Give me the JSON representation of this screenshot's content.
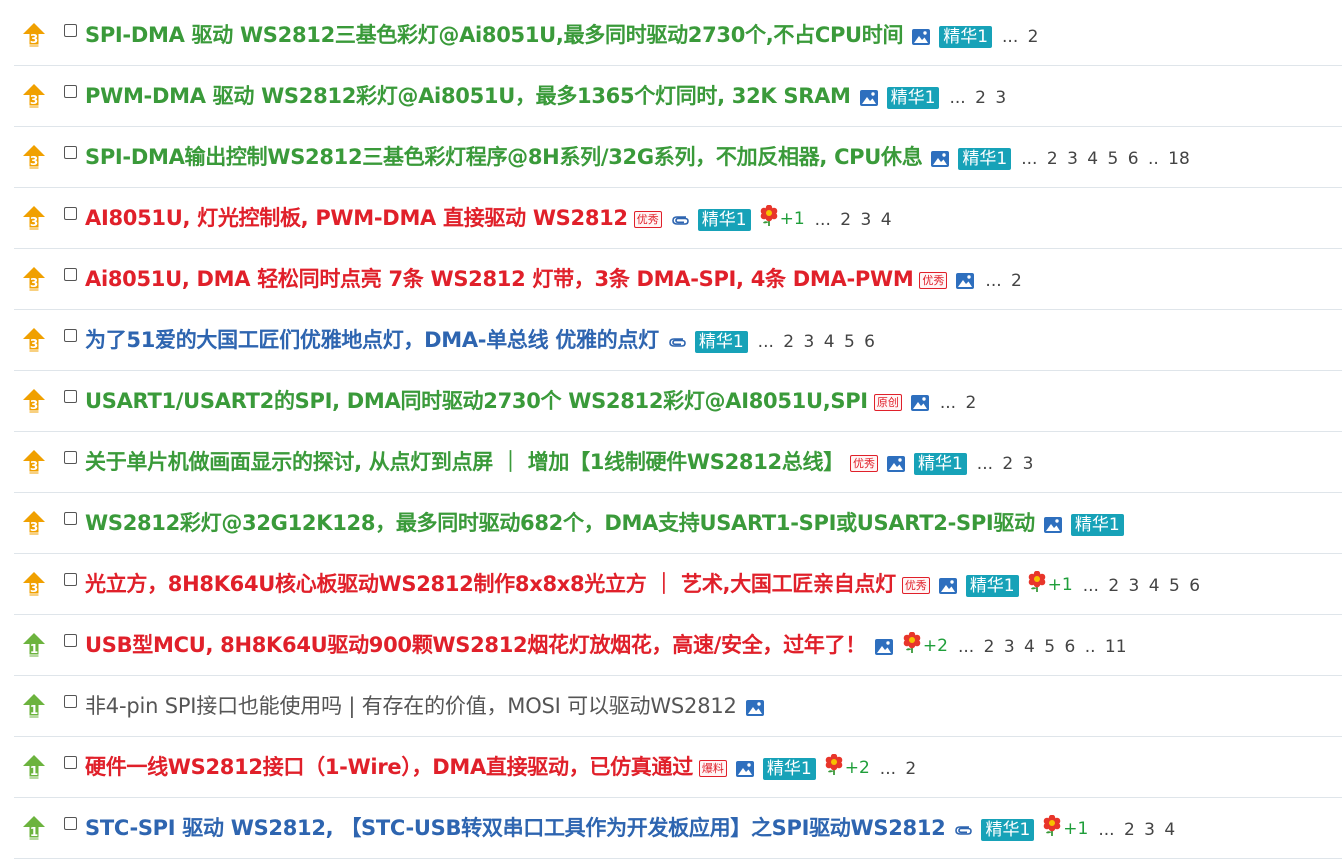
{
  "threads": [
    {
      "badge": "3",
      "badge_color": "#f0a000",
      "color": "green",
      "title": "SPI-DMA 驱动 WS2812三基色彩灯@Ai8051U,最多同时驱动2730个,不占CPU时间",
      "tag": "",
      "clip": false,
      "image": true,
      "jinghua": "精华1",
      "flower": "",
      "pages": "... 2"
    },
    {
      "badge": "3",
      "badge_color": "#f0a000",
      "color": "green",
      "title": "PWM-DMA 驱动 WS2812彩灯@Ai8051U，最多1365个灯同时, 32K SRAM",
      "tag": "",
      "clip": false,
      "image": true,
      "jinghua": "精华1",
      "flower": "",
      "pages": "... 2 3"
    },
    {
      "badge": "3",
      "badge_color": "#f0a000",
      "color": "green",
      "title": "SPI-DMA输出控制WS2812三基色彩灯程序@8H系列/32G系列，不加反相器, CPU休息",
      "tag": "",
      "clip": false,
      "image": true,
      "jinghua": "精华1",
      "flower": "",
      "pages": "... 2 3 4 5 6 .. 18"
    },
    {
      "badge": "3",
      "badge_color": "#f0a000",
      "color": "red",
      "title": "AI8051U, 灯光控制板, PWM-DMA 直接驱动 WS2812",
      "tag": "优秀",
      "clip": true,
      "image": false,
      "jinghua": "精华1",
      "flower": "+1",
      "pages": "... 2 3 4"
    },
    {
      "badge": "3",
      "badge_color": "#f0a000",
      "color": "red",
      "title": "Ai8051U, DMA 轻松同时点亮 7条 WS2812 灯带，3条 DMA-SPI, 4条 DMA-PWM",
      "tag": "优秀",
      "clip": false,
      "image": true,
      "jinghua": "",
      "flower": "",
      "pages": "... 2"
    },
    {
      "badge": "3",
      "badge_color": "#f0a000",
      "color": "blue",
      "title": "为了51爱的大国工匠们优雅地点灯，DMA-单总线 优雅的点灯",
      "tag": "",
      "clip": true,
      "image": false,
      "jinghua": "精华1",
      "flower": "",
      "pages": "... 2 3 4 5 6"
    },
    {
      "badge": "3",
      "badge_color": "#f0a000",
      "color": "green",
      "title": "USART1/USART2的SPI, DMA同时驱动2730个 WS2812彩灯@AI8051U,SPI",
      "tag": "原创",
      "clip": false,
      "image": true,
      "jinghua": "",
      "flower": "",
      "pages": "... 2"
    },
    {
      "badge": "3",
      "badge_color": "#f0a000",
      "color": "green",
      "title": "关于单片机做画面显示的探讨, 从点灯到点屏 ｜ 增加【1线制硬件WS2812总线】",
      "tag": "优秀",
      "clip": false,
      "image": true,
      "jinghua": "精华1",
      "flower": "",
      "pages": "... 2 3"
    },
    {
      "badge": "3",
      "badge_color": "#f0a000",
      "color": "green",
      "title": "WS2812彩灯@32G12K128，最多同时驱动682个，DMA支持USART1-SPI或USART2-SPI驱动",
      "tag": "",
      "clip": false,
      "image": true,
      "jinghua": "精华1",
      "flower": "",
      "pages": ""
    },
    {
      "badge": "3",
      "badge_color": "#f0a000",
      "color": "red",
      "title": "光立方，8H8K64U核心板驱动WS2812制作8x8x8光立方 ｜ 艺术,大国工匠亲自点灯",
      "tag": "优秀",
      "clip": false,
      "image": true,
      "jinghua": "精华1",
      "flower": "+1",
      "pages": "... 2 3 4 5 6"
    },
    {
      "badge": "1",
      "badge_color": "#6cb33e",
      "color": "red",
      "title": "USB型MCU, 8H8K64U驱动900颗WS2812烟花灯放烟花，高速/安全，过年了！",
      "tag": "",
      "clip": false,
      "image": true,
      "jinghua": "",
      "flower": "+2",
      "pages": "... 2 3 4 5 6 .. 11"
    },
    {
      "badge": "1",
      "badge_color": "#6cb33e",
      "color": "gray",
      "title": "非4-pin SPI接口也能使用吗 | 有存在的价值，MOSI 可以驱动WS2812",
      "tag": "",
      "clip": false,
      "image": true,
      "jinghua": "",
      "flower": "",
      "pages": ""
    },
    {
      "badge": "1",
      "badge_color": "#6cb33e",
      "color": "red",
      "title": "硬件一线WS2812接口（1-Wire），DMA直接驱动，已仿真通过",
      "tag": "爆料",
      "clip": false,
      "image": true,
      "jinghua": "精华1",
      "flower": "+2",
      "pages": "... 2"
    },
    {
      "badge": "1",
      "badge_color": "#6cb33e",
      "color": "blue",
      "title": "STC-SPI 驱动 WS2812, 【STC-USB转双串口工具作为开发板应用】之SPI驱动WS2812",
      "tag": "",
      "clip": true,
      "image": false,
      "jinghua": "精华1",
      "flower": "+1",
      "pages": "... 2 3 4"
    }
  ]
}
